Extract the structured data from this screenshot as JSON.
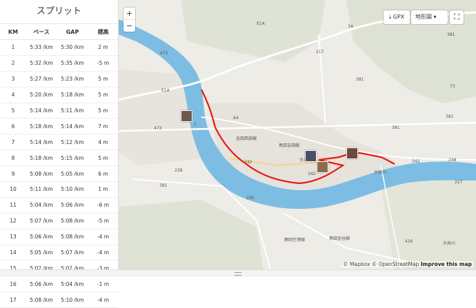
{
  "splits": {
    "title": "スプリット",
    "headers": [
      "KM",
      "ペース",
      "GAP",
      "標高"
    ],
    "rows": [
      [
        "1",
        "5:33 /km",
        "5:30 /km",
        "2 m"
      ],
      [
        "2",
        "5:32 /km",
        "5:35 /km",
        "-5 m"
      ],
      [
        "3",
        "5:27 /km",
        "5:23 /km",
        "5 m"
      ],
      [
        "4",
        "5:20 /km",
        "5:18 /km",
        "5 m"
      ],
      [
        "5",
        "5:14 /km",
        "5:11 /km",
        "5 m"
      ],
      [
        "6",
        "5:18 /km",
        "5:14 /km",
        "7 m"
      ],
      [
        "7",
        "5:14 /km",
        "5:12 /km",
        "4 m"
      ],
      [
        "8",
        "5:18 /km",
        "5:15 /km",
        "5 m"
      ],
      [
        "9",
        "5:08 /km",
        "5:05 /km",
        "6 m"
      ],
      [
        "10",
        "5:11 /km",
        "5:10 /km",
        "1 m"
      ],
      [
        "11",
        "5:04 /km",
        "5:06 /km",
        "-6 m"
      ],
      [
        "12",
        "5:07 /km",
        "5:08 /km",
        "-5 m"
      ],
      [
        "13",
        "5:06 /km",
        "5:08 /km",
        "-4 m"
      ],
      [
        "14",
        "5:05 /km",
        "5:07 /km",
        "-4 m"
      ],
      [
        "15",
        "5:02 /km",
        "5:02 /km",
        "-3 m"
      ],
      [
        "16",
        "5:06 /km",
        "5:04 /km",
        "-1 m"
      ],
      [
        "17",
        "5:08 /km",
        "5:10 /km",
        "-4 m"
      ]
    ]
  },
  "map": {
    "zoom_in": "+",
    "zoom_out": "−",
    "gpx_label": "GPX",
    "layer_label": "地形図",
    "attribution_mapbox": "© Mapbox",
    "attribution_osm": "© OpenStreetMap",
    "attribution_improve": "Improve this map",
    "labels": [
      "E1A",
      "E1A",
      "吉田西部線",
      "島田吉田線",
      "大井川",
      "大井川",
      "342",
      "342",
      "381",
      "230",
      "217",
      "64",
      "1",
      "473",
      "228",
      "381",
      "473",
      "248",
      "342",
      "381",
      "34",
      "381",
      "227",
      "73",
      "静岡空港線",
      "島田金谷線",
      "大井川",
      "416",
      "381"
    ],
    "route_color": "#e8190f",
    "river_color": "#7dbde3"
  }
}
